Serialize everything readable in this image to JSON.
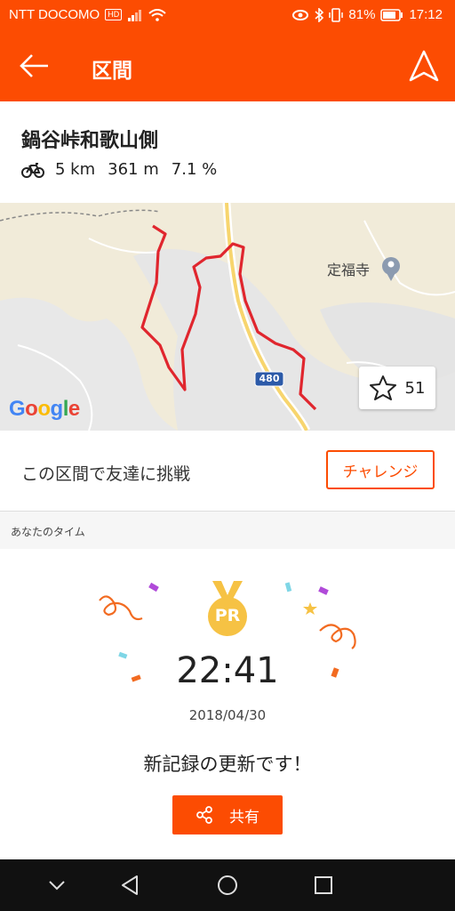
{
  "status_bar": {
    "carrier": "NTT DOCOMO",
    "hd_badge": "HD",
    "battery": "81%",
    "time": "17:12"
  },
  "app_bar": {
    "title": "区間",
    "back_icon": "arrow-left-icon",
    "nav_icon": "navigation-arrow-icon"
  },
  "segment": {
    "name": "鍋谷峠和歌山側",
    "distance": "5 km",
    "elevation": "361 m",
    "grade": "7.1 %"
  },
  "map": {
    "poi_label": "定福寺",
    "road_number": "480",
    "star_count": "51",
    "provider_logo": "Google"
  },
  "challenge": {
    "text": "この区間で友達に挑戦",
    "button_label": "チャレンジ"
  },
  "your_time": {
    "section_label": "あなたのタイム",
    "medal_text": "PR",
    "time": "22:41",
    "date": "2018/04/30",
    "message": "新記録の更新です！",
    "share_label": "共有"
  },
  "colors": {
    "accent": "#fc4c02",
    "route": "#e0262e",
    "medal": "#f6c244"
  }
}
